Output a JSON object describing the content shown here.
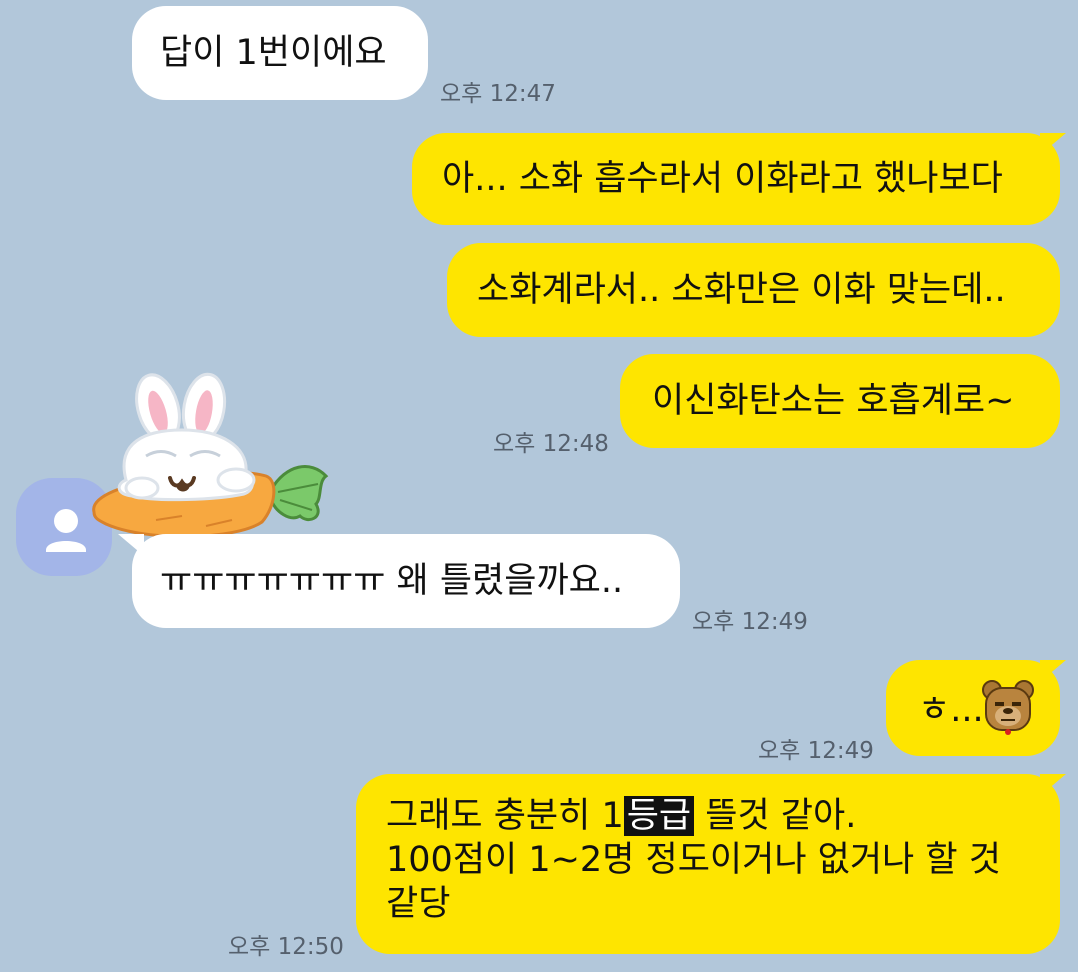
{
  "messages": [
    {
      "sender": "other",
      "text": "답이 1번이에요",
      "time": "오후 12:47"
    },
    {
      "sender": "me",
      "text": "아... 소화 흡수라서 이화라고 했나보다"
    },
    {
      "sender": "me",
      "text": "소화계라서.. 소화만은 이화 맞는데.."
    },
    {
      "sender": "me",
      "text": "이신화탄소는 호흡계로~",
      "time": "오후 12:48"
    },
    {
      "sender": "other",
      "sticker": "rabbit-on-carrot-sticker",
      "text": "ㅠㅠㅠㅠㅠㅠㅠ 왜 틀렸을까요..",
      "time": "오후 12:49"
    },
    {
      "sender": "me",
      "text": "ㅎ...",
      "emoji": "bear-face-emoji",
      "time": "오후 12:49"
    },
    {
      "sender": "me",
      "line1_pre": "그래도 충분히 1",
      "line1_highlight": "등급",
      "line1_post": " 뜰것 같아.",
      "line2": "100점이 1~2명 정도이거나 없거나 할 것",
      "line3": "같당",
      "time": "오후 12:50"
    }
  ],
  "colors": {
    "background": "#b2c7da",
    "outgoing": "#fee500",
    "incoming": "#ffffff",
    "avatar": "#a3b5e8"
  },
  "icons": {
    "avatar": "person-icon"
  }
}
